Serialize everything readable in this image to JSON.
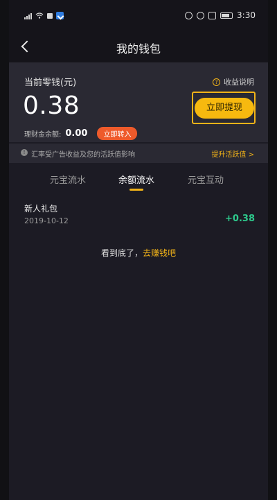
{
  "status_bar": {
    "time": "3:30",
    "icons": [
      "signal-icon",
      "wifi-icon",
      "notification-icon",
      "app-notify-icon",
      "nfc-icon",
      "alarm-icon",
      "vibrate-icon",
      "battery-icon"
    ]
  },
  "header": {
    "title": "我的钱包",
    "back_icon": "chevron-left-icon"
  },
  "balance": {
    "label": "当前零钱(元)",
    "value": "0.38",
    "income_info": "收益说明",
    "withdraw_button": "立即提现",
    "finance_label": "理财金余额:",
    "finance_amount": "0.00",
    "transfer_button": "立即转入"
  },
  "notice": {
    "text": "汇率受广告收益及您的活跃值影响",
    "action": "提升活跃值 >"
  },
  "tabs": [
    {
      "label": "元宝流水",
      "active": false
    },
    {
      "label": "余额流水",
      "active": true
    },
    {
      "label": "元宝互动",
      "active": false
    }
  ],
  "records": [
    {
      "title": "新人礼包",
      "date": "2019-10-12",
      "amount": "+0.38"
    }
  ],
  "footer": {
    "text": "看到底了，",
    "link": "去赚钱吧"
  },
  "colors": {
    "accent": "#f2b318",
    "positive": "#2dc98c",
    "transfer": "#ee5a2b",
    "background": "#1c1b24",
    "card": "#2a2933"
  }
}
